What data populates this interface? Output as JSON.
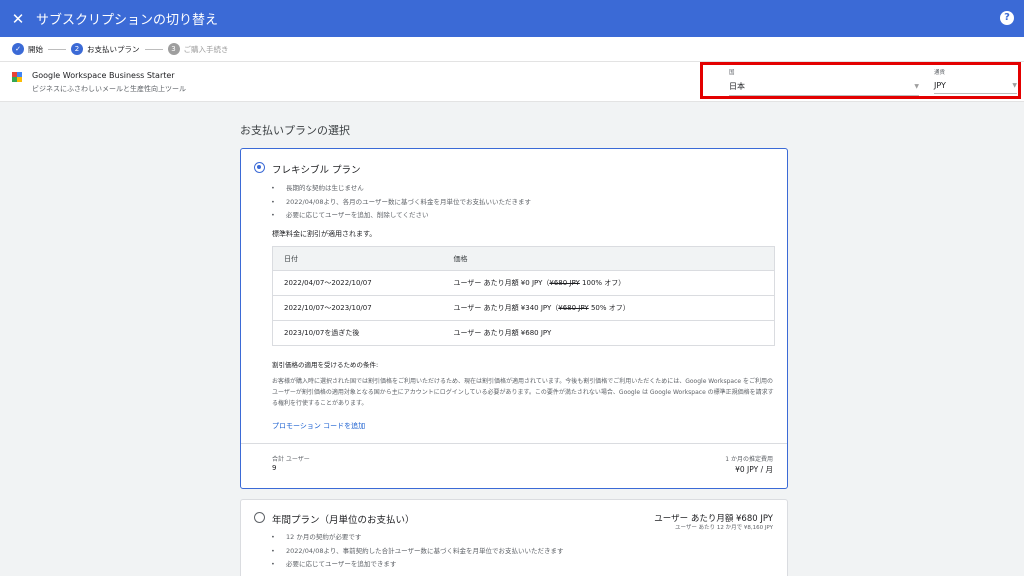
{
  "header": {
    "title": "サブスクリプションの切り替え",
    "close_glyph": "✕",
    "help_glyph": "?"
  },
  "stepper": [
    {
      "glyph": "✓",
      "label": "開始",
      "state": "done"
    },
    {
      "glyph": "2",
      "label": "お支払いプラン",
      "state": "active"
    },
    {
      "glyph": "3",
      "label": "ご購入手続き",
      "state": "pending"
    }
  ],
  "product": {
    "name": "Google Workspace Business Starter",
    "description": "ビジネスにふさわしいメールと生産性向上ツール"
  },
  "country_select": {
    "label": "国",
    "value": "日本"
  },
  "currency_select": {
    "label": "通貨",
    "value": "JPY"
  },
  "section_title": "お支払いプランの選択",
  "flexible_plan": {
    "title": "フレキシブル プラン",
    "bullets": [
      "長期的な契約は生じません",
      "2022/04/08より、各月のユーザー数に基づく料金を月単位でお支払いいただきます",
      "必要に応じてユーザーを追加、削除してください"
    ],
    "discount_heading": "標準料金に割引が適用されます。",
    "table_headers": {
      "date": "日付",
      "price": "価格"
    },
    "rows": [
      {
        "date": "2022/04/07～2022/10/07",
        "price_prefix": "ユーザー あたり月額 ¥0 JPY（",
        "price_strike": "¥680 JPY",
        "price_suffix": " 100% オフ）"
      },
      {
        "date": "2022/10/07～2023/10/07",
        "price_prefix": "ユーザー あたり月額 ¥340 JPY（",
        "price_strike": "¥680 JPY",
        "price_suffix": " 50% オフ）"
      },
      {
        "date": "2023/10/07を過ぎた後",
        "price_prefix": "ユーザー あたり月額 ¥680 JPY",
        "price_strike": "",
        "price_suffix": ""
      }
    ],
    "conditions_heading": "割引価格の適用を受けるための条件:",
    "conditions_body": "お客様が購入時に選択された国では割引価格をご利用いただけるため、現在は割引価格が適用されています。今後も割引価格でご利用いただくためには、Google Workspace をご利用のユーザーが割引価格の適用対象となる国から主にアカウントにログインしている必要があります。この要件が満たされない場合、Google は Google Workspace の標準正規価格を請求する権利を行使することがあります。",
    "promo_link": "プロモーション コードを追加",
    "total_users_label": "合計 ユーザー",
    "total_users_value": "9",
    "estimate_label": "1 か月の推定費用",
    "estimate_value": "¥0 JPY / 月"
  },
  "annual_plan": {
    "title": "年間プラン（月単位のお支払い）",
    "price": "ユーザー あたり月額 ¥680 JPY",
    "price_sub": "ユーザー あたり 12 か月で ¥8,160 JPY",
    "bullets": [
      "12 か月の契約が必要です",
      "2022/04/08より、事前契約した合計ユーザー数に基づく料金を月単位でお支払いいただきます",
      "必要に応じてユーザーを追加できます"
    ]
  }
}
